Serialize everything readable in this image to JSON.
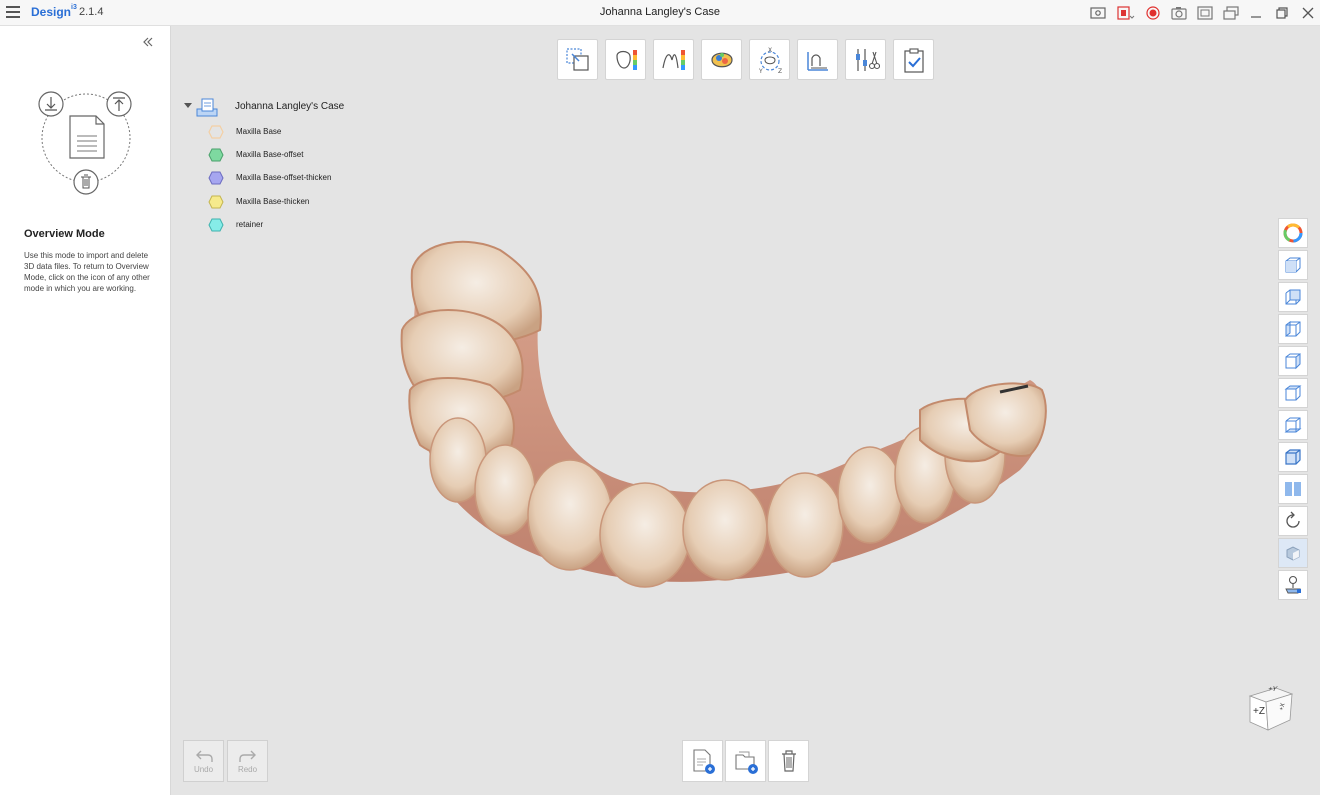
{
  "app": {
    "brand": "Design",
    "brand_sup": "i3",
    "version": "2.1.4",
    "window_title": "Johanna Langley's Case"
  },
  "left_panel": {
    "mode_title": "Overview Mode",
    "mode_description": "Use this mode to import and delete 3D data files. To return to Overview Mode, click on the icon of any other mode in which you are working."
  },
  "top_toolbar": {
    "tools": [
      "select-tool",
      "tooth-tool",
      "color-map-tool",
      "occlusion-tool",
      "axis-rotate-tool",
      "measure-tool",
      "adjust-tool",
      "checklist-tool"
    ]
  },
  "tree": {
    "root_label": "Johanna Langley's Case",
    "items": [
      {
        "label": "Maxilla Base",
        "color": "#f4cfa4",
        "filled": false
      },
      {
        "label": "Maxilla Base-offset",
        "color": "#7ed9a0",
        "filled": true
      },
      {
        "label": "Maxilla Base-offset-thicken",
        "color": "#a6a6f0",
        "filled": true
      },
      {
        "label": "Maxilla Base-thicken",
        "color": "#f6ea8c",
        "filled": true
      },
      {
        "label": "retainer",
        "color": "#86ece8",
        "filled": true
      }
    ]
  },
  "bottom": {
    "undo_label": "Undo",
    "redo_label": "Redo"
  },
  "viewcube": {
    "label_z": "+Z",
    "label_y": "+Y",
    "label_x": "+X"
  },
  "colors": {
    "accent": "#2a6fd6",
    "record": "#e0302e"
  }
}
